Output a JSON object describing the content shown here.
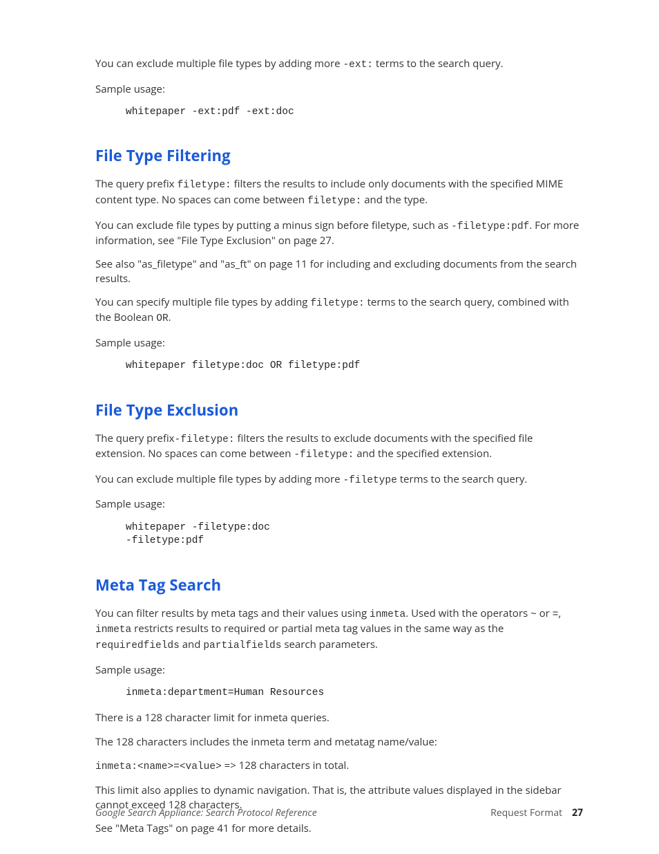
{
  "intro": {
    "p1a": "You can exclude multiple file types by adding more ",
    "p1code": "-ext:",
    "p1b": " terms to the search query.",
    "sample_label": "Sample usage:",
    "sample_code": "whitepaper -ext:pdf -ext:doc"
  },
  "section1": {
    "heading": "File Type Filtering",
    "p1a": "The query prefix ",
    "p1code1": "filetype:",
    "p1b": " filters the results to include only documents with the specified MIME content type. No spaces can come between ",
    "p1code2": "filetype:",
    "p1c": " and the type.",
    "p2a": "You can exclude file types by putting a minus sign before filetype, such as ",
    "p2code": "-filetype:pdf",
    "p2b": ". For more information, see \"File Type Exclusion\" on page 27.",
    "p3": "See also \"as_filetype\" and \"as_ft\" on page 11 for including and excluding documents from the search results.",
    "p4a": "You can specify multiple file types by adding ",
    "p4code": "filetype:",
    "p4b": " terms to the search query, combined with the Boolean ",
    "p4code2": "OR",
    "p4c": ".",
    "sample_label": "Sample usage:",
    "sample_code": "whitepaper filetype:doc OR filetype:pdf"
  },
  "section2": {
    "heading": "File Type Exclusion",
    "p1a": "The query prefix",
    "p1code1": "-filetype:",
    "p1b": " filters the results to exclude documents with the specified file extension. No spaces can come between ",
    "p1code2": "-filetype:",
    "p1c": " and the specified extension.",
    "p2a": "You can exclude multiple file types by adding more ",
    "p2code": "-filetype",
    "p2b": " terms to the search query.",
    "sample_label": "Sample usage:",
    "sample_code": "whitepaper -filetype:doc\n-filetype:pdf"
  },
  "section3": {
    "heading": "Meta Tag Search",
    "p1a": "You can filter results by meta tags and their values using ",
    "p1code1": "inmeta",
    "p1b": ". Used with the operators ",
    "p1code2": "~",
    "p1c": " or ",
    "p1code3": "=",
    "p1d": ", ",
    "p1code4": "inmeta",
    "p1e": " restricts results to required or partial meta tag values in the same way as the ",
    "p1code5": "requiredfields",
    "p1f": " and ",
    "p1code6": "partialfields",
    "p1g": " search parameters.",
    "sample_label": "Sample usage:",
    "sample_code": "inmeta:department=Human Resources",
    "p2": "There is a 128 character limit for inmeta queries.",
    "p3": "The 128 characters includes the inmeta term and metatag name/value:",
    "p4code": "inmeta:<name>=<value>",
    "p4b": "  => 128 characters in total.",
    "p5": "This limit also applies to dynamic navigation. That is, the attribute values displayed in the sidebar cannot exceed 128 characters.",
    "p6": "See \"Meta Tags\" on page 41 for more details."
  },
  "footer": {
    "doc_title": "Google Search Appliance: Search Protocol Reference",
    "section": "Request Format",
    "page": "27"
  }
}
